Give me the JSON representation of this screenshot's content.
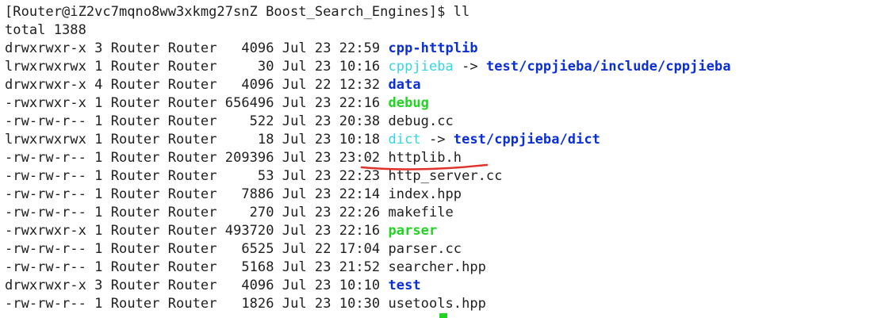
{
  "prompt": "[Router@iZ2vc7mqno8ww3xkmg27snZ Boost_Search_Engines]$ ll",
  "total": "total 1388",
  "entries": [
    {
      "perm": "drwxrwxr-x",
      "links": "3",
      "owner": "Router",
      "group": "Router",
      "size": "  4096",
      "date": "Jul 23 22:59",
      "name": "cpp-httplib",
      "kind": "dir"
    },
    {
      "perm": "lrwxrwxrwx",
      "links": "1",
      "owner": "Router",
      "group": "Router",
      "size": "    30",
      "date": "Jul 23 10:16",
      "name": "cppjieba",
      "kind": "link",
      "arrow": " -> ",
      "target": "test/cppjieba/include/cppjieba"
    },
    {
      "perm": "drwxrwxr-x",
      "links": "4",
      "owner": "Router",
      "group": "Router",
      "size": "  4096",
      "date": "Jul 22 12:32",
      "name": "data",
      "kind": "dir"
    },
    {
      "perm": "-rwxrwxr-x",
      "links": "1",
      "owner": "Router",
      "group": "Router",
      "size": "656496",
      "date": "Jul 23 22:16",
      "name": "debug",
      "kind": "exec"
    },
    {
      "perm": "-rw-rw-r--",
      "links": "1",
      "owner": "Router",
      "group": "Router",
      "size": "   522",
      "date": "Jul 23 20:38",
      "name": "debug.cc",
      "kind": "file"
    },
    {
      "perm": "lrwxrwxrwx",
      "links": "1",
      "owner": "Router",
      "group": "Router",
      "size": "    18",
      "date": "Jul 23 10:18",
      "name": "dict",
      "kind": "link",
      "arrow": " -> ",
      "target": "test/cppjieba/dict"
    },
    {
      "perm": "-rw-rw-r--",
      "links": "1",
      "owner": "Router",
      "group": "Router",
      "size": "209396",
      "date": "Jul 23 23:02",
      "name": "httplib.h",
      "kind": "file"
    },
    {
      "perm": "-rw-rw-r--",
      "links": "1",
      "owner": "Router",
      "group": "Router",
      "size": "    53",
      "date": "Jul 23 22:23",
      "name": "http_server.cc",
      "kind": "file"
    },
    {
      "perm": "-rw-rw-r--",
      "links": "1",
      "owner": "Router",
      "group": "Router",
      "size": "  7886",
      "date": "Jul 23 22:14",
      "name": "index.hpp",
      "kind": "file"
    },
    {
      "perm": "-rw-rw-r--",
      "links": "1",
      "owner": "Router",
      "group": "Router",
      "size": "   270",
      "date": "Jul 23 22:26",
      "name": "makefile",
      "kind": "file"
    },
    {
      "perm": "-rwxrwxr-x",
      "links": "1",
      "owner": "Router",
      "group": "Router",
      "size": "493720",
      "date": "Jul 23 22:16",
      "name": "parser",
      "kind": "exec"
    },
    {
      "perm": "-rw-rw-r--",
      "links": "1",
      "owner": "Router",
      "group": "Router",
      "size": "  6525",
      "date": "Jul 22 17:04",
      "name": "parser.cc",
      "kind": "file"
    },
    {
      "perm": "-rw-rw-r--",
      "links": "1",
      "owner": "Router",
      "group": "Router",
      "size": "  5168",
      "date": "Jul 23 21:52",
      "name": "searcher.hpp",
      "kind": "file"
    },
    {
      "perm": "drwxrwxr-x",
      "links": "3",
      "owner": "Router",
      "group": "Router",
      "size": "  4096",
      "date": "Jul 23 10:10",
      "name": "test",
      "kind": "dir"
    },
    {
      "perm": "-rw-rw-r--",
      "links": "1",
      "owner": "Router",
      "group": "Router",
      "size": "  1826",
      "date": "Jul 23 10:30",
      "name": "usetools.hpp",
      "kind": "file"
    }
  ],
  "colors": {
    "directory": "#0b2fd6",
    "executable": "#22d422",
    "symlink": "#35d6e0",
    "text": "#1e1e1e",
    "annotation": "#e0312a",
    "cursor": "#22d422"
  }
}
